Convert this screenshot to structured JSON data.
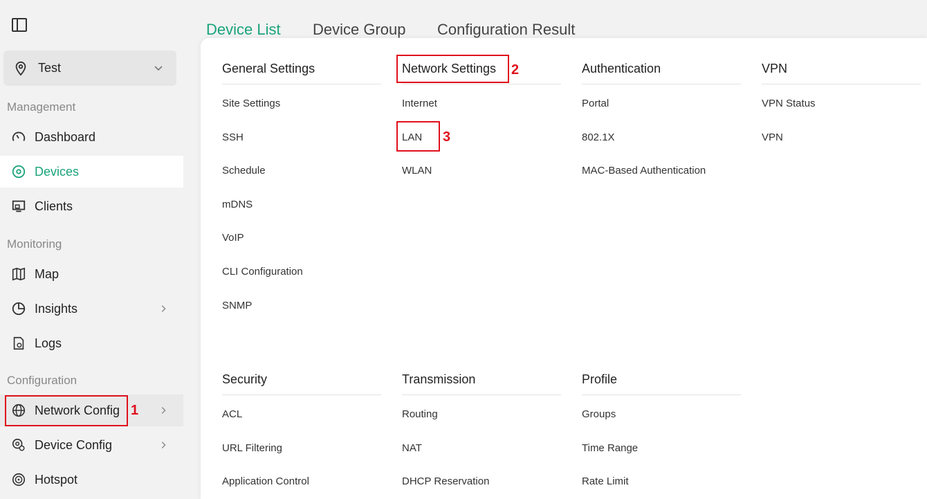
{
  "sidebar": {
    "site": {
      "label": "Test"
    },
    "sections": {
      "management": "Management",
      "monitoring": "Monitoring",
      "configuration": "Configuration"
    },
    "items": {
      "dashboard": "Dashboard",
      "devices": "Devices",
      "clients": "Clients",
      "map": "Map",
      "insights": "Insights",
      "logs": "Logs",
      "network_config": "Network Config",
      "device_config": "Device Config",
      "hotspot": "Hotspot"
    }
  },
  "tabs": [
    "Device List",
    "Device Group",
    "Configuration Result"
  ],
  "menu": {
    "general_settings": {
      "title": "General Settings",
      "items": [
        "Site Settings",
        "SSH",
        "Schedule",
        "mDNS",
        "VoIP",
        "CLI Configuration",
        "SNMP"
      ]
    },
    "network_settings": {
      "title": "Network Settings",
      "items": [
        "Internet",
        "LAN",
        "WLAN"
      ]
    },
    "authentication": {
      "title": "Authentication",
      "items": [
        "Portal",
        "802.1X",
        "MAC-Based Authentication"
      ]
    },
    "vpn": {
      "title": "VPN",
      "items": [
        "VPN Status",
        "VPN"
      ]
    },
    "security": {
      "title": "Security",
      "items": [
        "ACL",
        "URL Filtering",
        "Application Control"
      ]
    },
    "transmission": {
      "title": "Transmission",
      "items": [
        "Routing",
        "NAT",
        "DHCP Reservation"
      ]
    },
    "profile": {
      "title": "Profile",
      "items": [
        "Groups",
        "Time Range",
        "Rate Limit"
      ]
    }
  },
  "annotations": [
    "1",
    "2",
    "3"
  ],
  "colors": {
    "accent": "#1aa37a",
    "annotation": "#e0101c"
  }
}
